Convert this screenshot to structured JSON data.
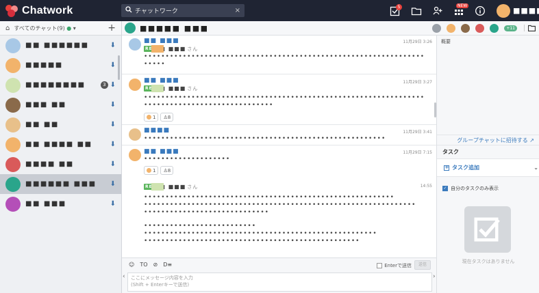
{
  "app": {
    "brand": "Chatwork",
    "search_placeholder": "チャットワーク",
    "search_clear": "×",
    "tasks_badge": "5",
    "new_badge": "NEW",
    "user_name": "■■■■"
  },
  "sidebar": {
    "home_icon": "⌂",
    "filter_label": "すべてのチャット(9)",
    "add": "+",
    "rooms": [
      {
        "name": "■■ ■■■■■■",
        "color": "blue",
        "badge": ""
      },
      {
        "name": "■■■■■",
        "color": "orange",
        "badge": ""
      },
      {
        "name": "■■■■■■■■",
        "color": "green",
        "badge": "3"
      },
      {
        "name": "■■■ ■■",
        "color": "brown",
        "badge": ""
      },
      {
        "name": "■■ ■■",
        "color": "tan",
        "badge": ""
      },
      {
        "name": "■■ ■■■■ ■■",
        "color": "orange",
        "badge": ""
      },
      {
        "name": "■■■■ ■■",
        "color": "red",
        "badge": ""
      },
      {
        "name": "■■■■■■ ■■■",
        "color": "teal",
        "badge": ""
      },
      {
        "name": "■■ ■■■",
        "color": "purple",
        "badge": ""
      }
    ]
  },
  "room": {
    "title": "■■■■■ ■■■",
    "more_members": "+11"
  },
  "messages": [
    {
      "who": "■■ ■■■",
      "time": "11月29日 3:26",
      "reply_to": "■■ ■■■",
      "lines": [
        "•••••••••••••••••••••••••••••••••••••••••••••••••••••••••••••••••",
        "•••••"
      ]
    },
    {
      "who": "■■ ■■■",
      "time": "11月29日 3:27",
      "reply_to": "■■ ■■■",
      "lines": [
        "•••••••••••••••••••••••••••••••••••••••••••••••••••••••••••••••••",
        "••••••••••••••••••••••••••••••"
      ],
      "reactions": [
        "1",
        "8"
      ]
    },
    {
      "who": "■■■■",
      "time": "11月29日 3:41",
      "lines": [
        "••••••••••••••••••••••••••••••••••••••••••••••••••••••••"
      ]
    },
    {
      "who": "■■ ■■■",
      "time": "11月29日 7:15",
      "lines": [
        "••••••••••••••••••••"
      ],
      "reactions": [
        "1",
        "8"
      ]
    },
    {
      "who": "",
      "time": "14:55",
      "reply_to": "■■ ■■■",
      "lines": [
        "••••••••••••••••••••••••••••••••••••••••••••••••••••••••••",
        "•••••••••••••••••••••••••••••••••••••••••••••••••••••••••••••••",
        "•••••••••••••••••••••••••••••",
        "••••••••••••••••••••••••••",
        "••••••••••••••••••••••••••••••••••••••••••••••••••••••",
        "••••••••••••••••••••••••••••••••••••••••••••••••••"
      ]
    }
  ],
  "reply_tag": "RE",
  "san": "さん",
  "composer": {
    "emoji": "☺",
    "to": "TO",
    "file": "⊘",
    "tag": "D≡",
    "enter_option": "Enterで送信",
    "send": "送信",
    "placeholder_line1": "ここにメッセージ内容を入力",
    "placeholder_line2": "(Shift + Enterキーで送信)"
  },
  "right_pane": {
    "summary": "概要",
    "invite": "グループチャットに招待する ↗",
    "tasks_title": "タスク",
    "add_task": "タスク追加",
    "mine_only": "自分のタスクのみ表示",
    "empty": "現在タスクはありません"
  }
}
